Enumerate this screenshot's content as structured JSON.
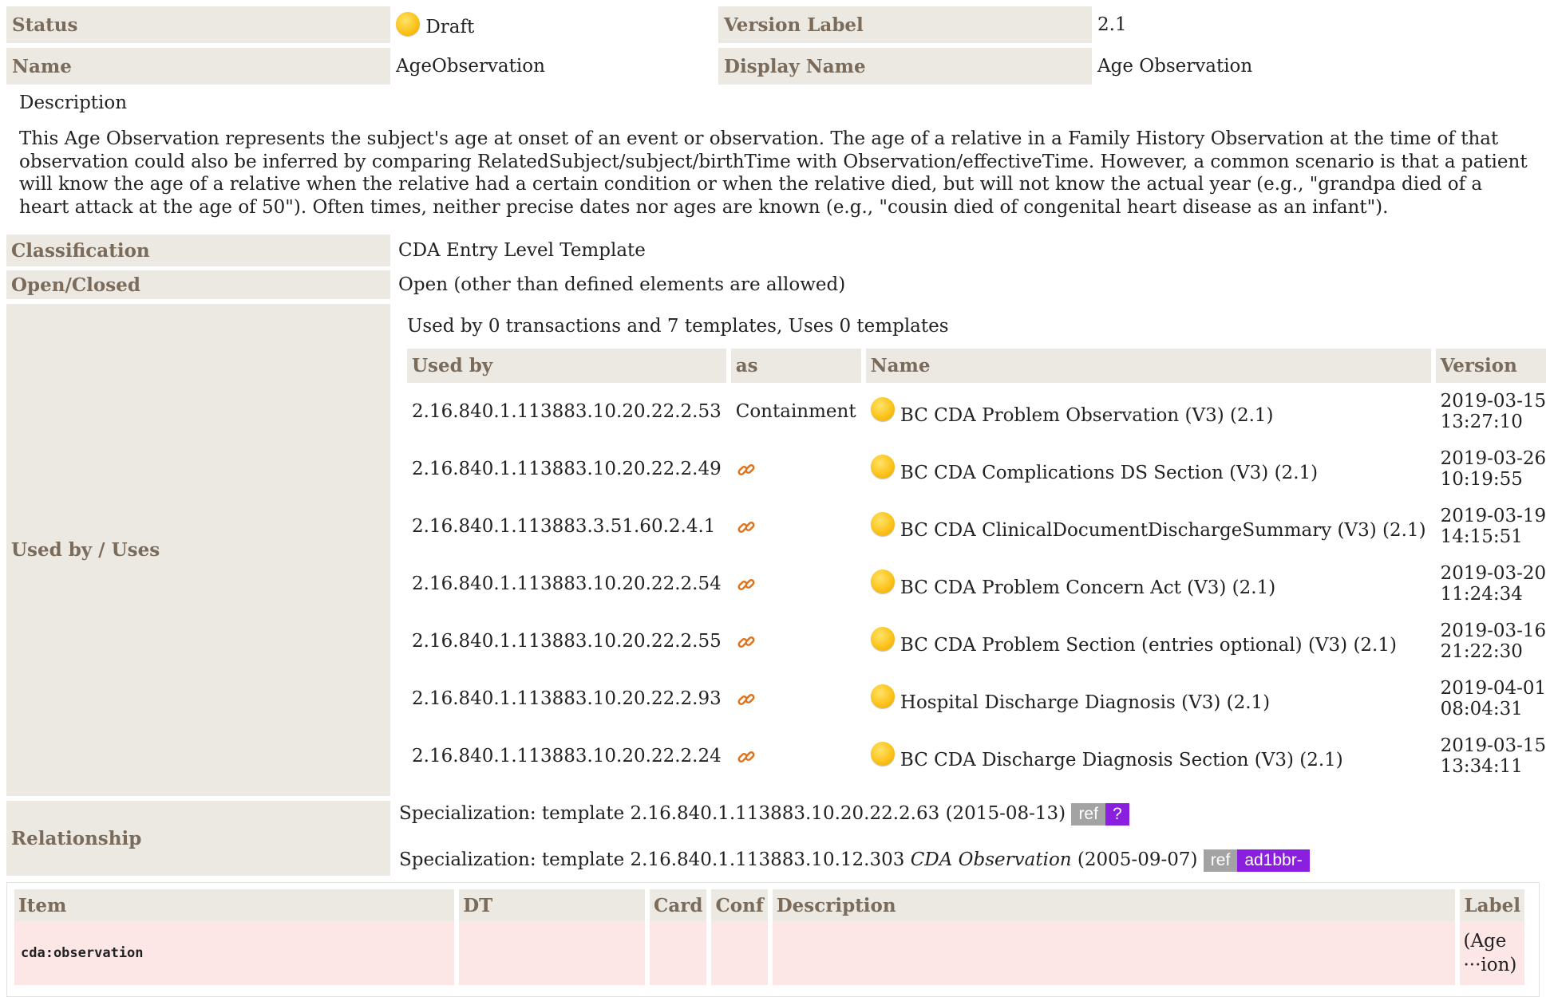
{
  "header": {
    "status_label": "Status",
    "status_value": "Draft",
    "version_label_label": "Version Label",
    "version_label_value": "2.1",
    "name_label": "Name",
    "name_value": "AgeObservation",
    "display_name_label": "Display Name",
    "display_name_value": "Age Observation"
  },
  "description": {
    "title": "Description",
    "text": "This Age Observation represents the subject's age at onset of an event or observation. The age of a relative in a Family History Observation at the time of that observation could also be inferred by comparing RelatedSubject/subject/birthTime with Observation/effectiveTime. However, a common scenario is that a patient will know the age of a relative when the relative had a certain condition or when the relative died, but will not know the actual year (e.g., \"grandpa died of a heart attack at the age of 50\"). Often times, neither precise dates nor ages are known (e.g., \"cousin died of congenital heart disease as an infant\")."
  },
  "classification": {
    "label": "Classification",
    "value": "CDA Entry Level Template"
  },
  "open_closed": {
    "label": "Open/Closed",
    "value": "Open (other than defined elements are allowed)"
  },
  "used_by": {
    "label": "Used by / Uses",
    "summary": "Used by 0 transactions and 7 templates, Uses 0 templates",
    "columns": [
      "Used by",
      "as",
      "Name",
      "Version"
    ],
    "rows": [
      {
        "oid": "2.16.840.1.113883.10.20.22.2.53",
        "as": "Containment",
        "name": "BC CDA Problem Observation (V3) (2.1)",
        "date": "2019-03-15",
        "time": "13:27:10"
      },
      {
        "oid": "2.16.840.1.113883.10.20.22.2.49",
        "as": "",
        "name": "BC CDA Complications DS Section (V3) (2.1)",
        "date": "2019-03-26",
        "time": "10:19:55"
      },
      {
        "oid": "2.16.840.1.113883.3.51.60.2.4.1",
        "as": "",
        "name": "BC CDA ClinicalDocumentDischargeSummary (V3) (2.1)",
        "date": "2019-03-19",
        "time": "14:15:51"
      },
      {
        "oid": "2.16.840.1.113883.10.20.22.2.54",
        "as": "",
        "name": "BC CDA Problem Concern Act (V3) (2.1)",
        "date": "2019-03-20",
        "time": "11:24:34"
      },
      {
        "oid": "2.16.840.1.113883.10.20.22.2.55",
        "as": "",
        "name": "BC CDA Problem Section (entries optional) (V3) (2.1)",
        "date": "2019-03-16",
        "time": "21:22:30"
      },
      {
        "oid": "2.16.840.1.113883.10.20.22.2.93",
        "as": "",
        "name": "Hospital Discharge Diagnosis (V3) (2.1)",
        "date": "2019-04-01",
        "time": "08:04:31"
      },
      {
        "oid": "2.16.840.1.113883.10.20.22.2.24",
        "as": "",
        "name": "BC CDA Discharge Diagnosis Section (V3) (2.1)",
        "date": "2019-03-15",
        "time": "13:34:11"
      }
    ]
  },
  "relationship": {
    "label": "Relationship",
    "spec1_prefix": "Specialization: template 2.16.840.1.113883.10.20.22.2.63 (2015-08-13)",
    "spec1_ref": "ref",
    "spec1_tag": "?",
    "spec2_prefix": "Specialization: template 2.16.840.1.113883.10.12.303",
    "spec2_name": "CDA Observation",
    "spec2_date": "(2005-09-07)",
    "spec2_ref": "ref",
    "spec2_tag": "ad1bbr-"
  },
  "items": {
    "columns": [
      "Item",
      "DT",
      "Card",
      "Conf",
      "Description",
      "Label"
    ],
    "row": {
      "item": "cda:observation",
      "label_line1": "(Age",
      "label_line2": "···ion)"
    }
  }
}
